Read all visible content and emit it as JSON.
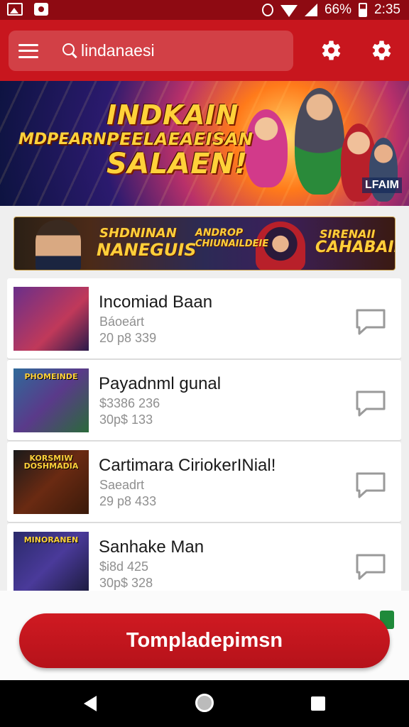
{
  "status_bar": {
    "battery": "66%",
    "time": "2:35",
    "icons": [
      "image-icon",
      "bag-icon",
      "alarm-icon",
      "wifi-icon",
      "signal-icon",
      "battery-icon"
    ]
  },
  "app_bar": {
    "search_text": "lindanaesi",
    "icons": [
      "menu-icon",
      "search-icon",
      "settings-icon",
      "settings-icon"
    ],
    "color": "#c8161e"
  },
  "hero_banner": {
    "line1": "INDKAIN",
    "line2": "PEELAEAEISAN",
    "line3": "SALAEN!",
    "side_text": "MDPEARN",
    "tag": "LFAIM"
  },
  "promo_banner": {
    "text1": "SHDNINAN",
    "text2": "NANEGUIS",
    "text3": "ANDROP",
    "text4": "CHIUNAILDEIE",
    "text5": "SIRENAII",
    "text6": "CAHABAIR"
  },
  "list": {
    "items": [
      {
        "title": "Incomiad Baan",
        "sub1": "Báoeárt",
        "sub2": "20 p8 339",
        "thumb_text": "",
        "thumb": "#6a2f8a"
      },
      {
        "title": "Payadnml gunal",
        "sub1": "$3386 236",
        "sub2": "30p$ 133",
        "thumb_text": "PHOMEINDE",
        "thumb": "#2f6a9a"
      },
      {
        "title": "Cartimara CiriokerINial!",
        "sub1": "Saeadrt",
        "sub2": "29 p8 433",
        "thumb_text": "KORSMIW DOSHMADIA",
        "thumb": "#6a2a12"
      },
      {
        "title": "Sanhake Man",
        "sub1": "$i8d 425",
        "sub2": "30p$ 328",
        "thumb_text": "MINORANEN",
        "thumb": "#2a2a6a"
      }
    ]
  },
  "cta": {
    "label": "Tompladepimsn",
    "color": "#c8161e"
  },
  "nav_bar": {
    "icons": [
      "back-icon",
      "home-icon",
      "recents-icon"
    ]
  }
}
